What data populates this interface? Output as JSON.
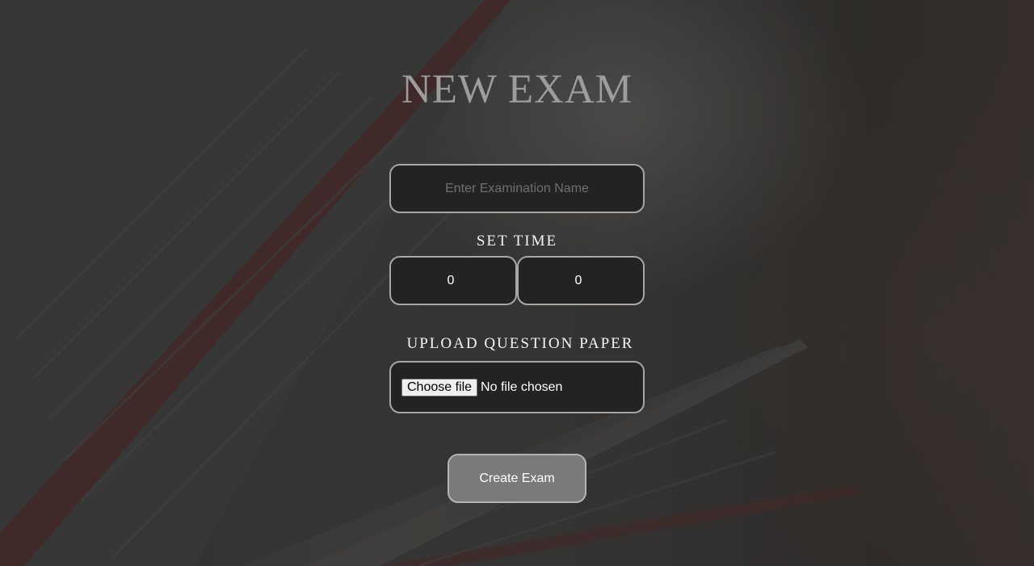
{
  "page": {
    "title": "NEW EXAM"
  },
  "exam_name": {
    "placeholder": "Enter Examination Name",
    "value": ""
  },
  "set_time": {
    "label": "SET TIME",
    "hours": "0",
    "minutes": "0"
  },
  "upload": {
    "label": "UPLOAD QUESTION PAPER",
    "button_label": "Choose file",
    "status": "No file chosen"
  },
  "actions": {
    "create_label": "Create Exam"
  },
  "colors": {
    "field_bg": "#232323",
    "field_border": "#a8a7a6",
    "button_bg": "#7b7a7a",
    "title": "#9f9c9c"
  }
}
